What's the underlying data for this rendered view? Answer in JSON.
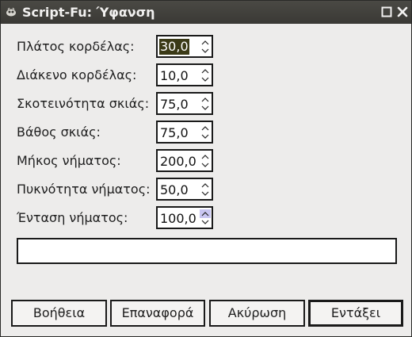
{
  "window": {
    "title": "Script-Fu: Ύφανση"
  },
  "fields": [
    {
      "label": "Πλάτος κορδέλας:",
      "value": "30,0"
    },
    {
      "label": "Διάκενο κορδέλας:",
      "value": "10,0"
    },
    {
      "label": "Σκοτεινότητα σκιάς:",
      "value": "75,0"
    },
    {
      "label": "Βάθος σκιάς:",
      "value": "75,0"
    },
    {
      "label": "Μήκος νήματος:",
      "value": "200,0"
    },
    {
      "label": "Πυκνότητα νήματος:",
      "value": "50,0"
    },
    {
      "label": "Ένταση νήματος:",
      "value": "100,0"
    }
  ],
  "progress": {
    "text": ""
  },
  "buttons": {
    "help": "Βοήθεια",
    "reset": "Επαναφορά",
    "cancel": "Ακύρωση",
    "ok": "Εντάξει"
  },
  "icons": {
    "app": "gimp-icon",
    "maximize": "maximize-icon",
    "close": "close-icon"
  }
}
